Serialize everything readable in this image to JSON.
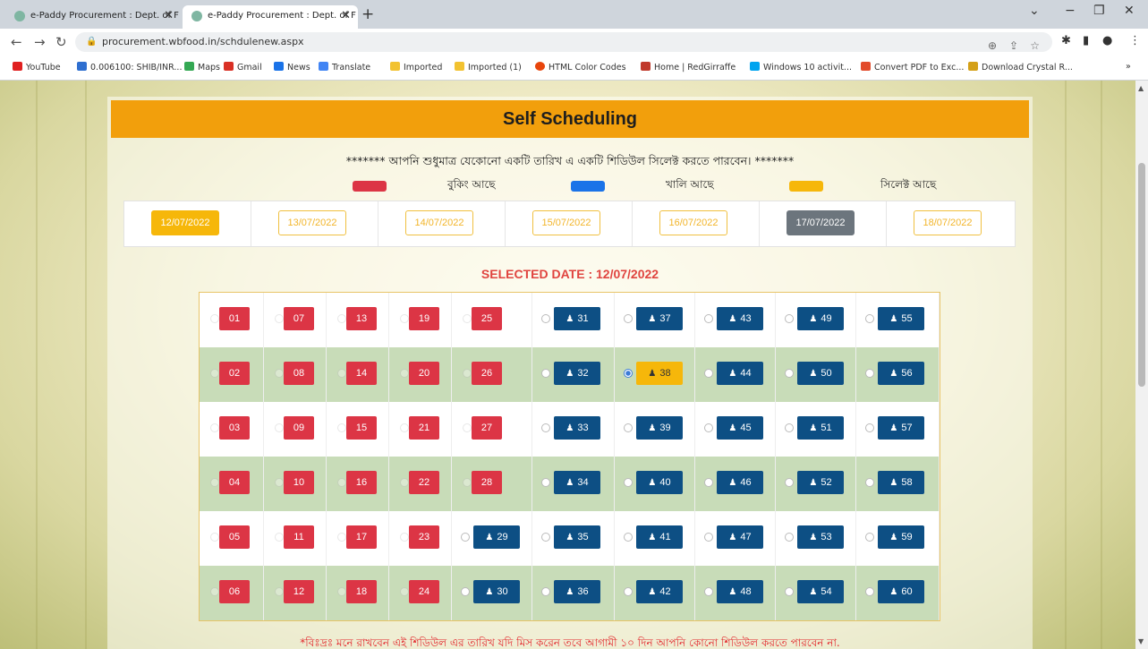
{
  "browser": {
    "tabs": [
      {
        "title": "e-Paddy Procurement : Dept. of F"
      },
      {
        "title": "e-Paddy Procurement : Dept. of F"
      }
    ],
    "url": "procurement.wbfood.in/schdulenew.aspx",
    "bookmarks": [
      {
        "label": "YouTube",
        "color": "#e02020"
      },
      {
        "label": "0.006100: SHIB/INR...",
        "color": "#2f6fd0"
      },
      {
        "label": "Maps",
        "color": "#34a853"
      },
      {
        "label": "Gmail",
        "color": "#d93025"
      },
      {
        "label": "News",
        "color": "#1a73e8"
      },
      {
        "label": "Translate",
        "color": "#4285f4"
      },
      {
        "label": "Imported",
        "color": "#f2c230"
      },
      {
        "label": "Imported (1)",
        "color": "#f2c230"
      },
      {
        "label": "HTML Color Codes",
        "color": "#e8450c"
      },
      {
        "label": "Home | RedGirraffe",
        "color": "#c0392b"
      },
      {
        "label": "Windows 10 activit...",
        "color": "#00a4ef"
      },
      {
        "label": "Convert PDF to Exc...",
        "color": "#e24b2b"
      },
      {
        "label": "Download Crystal R...",
        "color": "#d4a017"
      }
    ]
  },
  "page": {
    "title": "Self Scheduling",
    "note": "******* আপনি শুধুমাত্র যেকোনো একটি তারিখ এ একটি শিডিউল সিলেক্ট করতে পারবেন। *******",
    "legend": [
      {
        "label": "বুকিং আছে",
        "color": "#dc3545"
      },
      {
        "label": "খালি আছে",
        "color": "#1a73e8"
      },
      {
        "label": "সিলেক্ট আছে",
        "color": "#f6b70a"
      }
    ],
    "dates": [
      {
        "label": "12/07/2022",
        "state": "selected"
      },
      {
        "label": "13/07/2022",
        "state": "normal"
      },
      {
        "label": "14/07/2022",
        "state": "normal"
      },
      {
        "label": "15/07/2022",
        "state": "normal"
      },
      {
        "label": "16/07/2022",
        "state": "normal"
      },
      {
        "label": "17/07/2022",
        "state": "disabled"
      },
      {
        "label": "18/07/2022",
        "state": "normal"
      }
    ],
    "selected_date": "SELECTED DATE : 12/07/2022",
    "selected_slot": "38",
    "slot_rows": [
      [
        "01",
        "07",
        "13",
        "19",
        "25",
        "31",
        "37",
        "43",
        "49",
        "55"
      ],
      [
        "02",
        "08",
        "14",
        "20",
        "26",
        "32",
        "38",
        "44",
        "50",
        "56"
      ],
      [
        "03",
        "09",
        "15",
        "21",
        "27",
        "33",
        "39",
        "45",
        "51",
        "57"
      ],
      [
        "04",
        "10",
        "16",
        "22",
        "28",
        "34",
        "40",
        "46",
        "52",
        "58"
      ],
      [
        "05",
        "11",
        "17",
        "23",
        "29",
        "35",
        "41",
        "47",
        "53",
        "59"
      ],
      [
        "06",
        "12",
        "18",
        "24",
        "30",
        "36",
        "42",
        "48",
        "54",
        "60"
      ]
    ],
    "booked_slots": [
      "01",
      "02",
      "03",
      "04",
      "05",
      "06",
      "07",
      "08",
      "09",
      "10",
      "11",
      "12",
      "13",
      "14",
      "15",
      "16",
      "17",
      "18",
      "19",
      "20",
      "21",
      "22",
      "23",
      "24",
      "25",
      "26",
      "27",
      "28"
    ],
    "warning": "*বিঃদ্রঃ মনে রাখবেন এই শিডিউল এর তারিখ যদি মিস করেন তবে আগামী ১০ দিন আপনি কোনো শিডিউল করতে পারবেন না."
  }
}
